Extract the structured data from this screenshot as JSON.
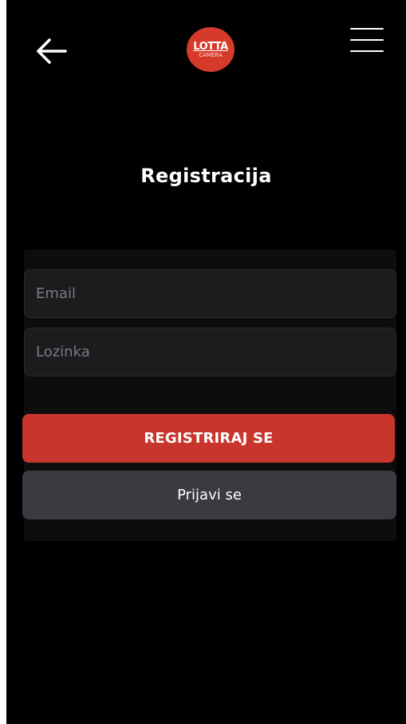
{
  "header": {
    "back_icon": "arrow-left-icon",
    "menu_icon": "hamburger-menu-icon",
    "logo": {
      "line1": "LOTTA",
      "line2": "CAMERA",
      "color": "#d63a2b"
    }
  },
  "page": {
    "title": "Registracija"
  },
  "form": {
    "email_placeholder": "Email",
    "password_placeholder": "Lozinka",
    "register_label": "REGISTRIRAJ SE",
    "login_label": "Prijavi se"
  },
  "colors": {
    "background": "#000000",
    "primary": "#c7352c",
    "secondary": "#3a3b41",
    "input_bg": "#1c1c1f"
  }
}
